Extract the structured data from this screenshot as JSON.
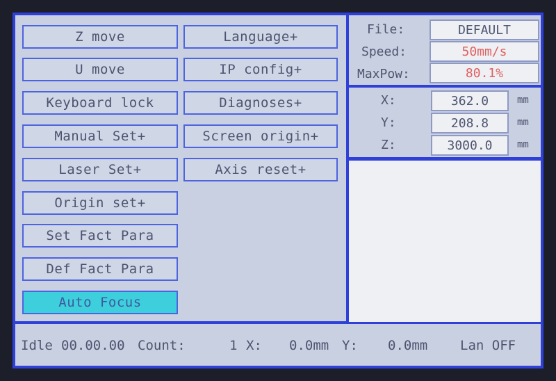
{
  "menu": {
    "z_move": "Z move",
    "u_move": "U move",
    "keyboard_lock": "Keyboard lock",
    "manual_set": "Manual Set+",
    "laser_set": "Laser Set+",
    "origin_set": "Origin set+",
    "set_fact_para": "Set Fact Para",
    "def_fact_para": "Def Fact Para",
    "auto_focus": "Auto Focus",
    "language": "Language+",
    "ip_config": "IP config+",
    "diagnoses": "Diagnoses+",
    "screen_origin": "Screen origin+",
    "axis_reset": "Axis reset+"
  },
  "info": {
    "file_label": "File:",
    "file_value": "DEFAULT",
    "speed_label": "Speed:",
    "speed_value": "50mm/s",
    "maxpow_label": "MaxPow:",
    "maxpow_value": "80.1%"
  },
  "coords": {
    "x_label": "X:",
    "x_value": "362.0",
    "x_unit": "mm",
    "y_label": "Y:",
    "y_value": "208.8",
    "y_unit": "mm",
    "z_label": "Z:",
    "z_value": "3000.0",
    "z_unit": "mm"
  },
  "status": {
    "state": "Idle",
    "time": "00.00.00",
    "count_label": "Count:",
    "count_value": "1",
    "x_label": "X:",
    "x_value": "0.0mm",
    "y_label": "Y:",
    "y_value": "0.0mm",
    "lan": "Lan OFF"
  },
  "colors": {
    "frame": "#2f40d8",
    "panel": "#c9d0e1",
    "active_button": "#3ecfdc",
    "highlight_text": "#e06060"
  }
}
